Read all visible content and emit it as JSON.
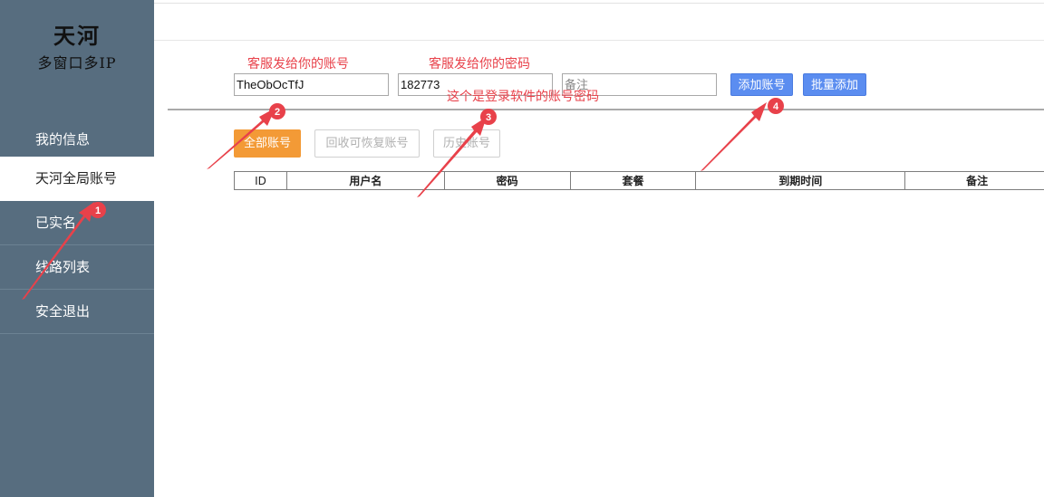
{
  "brand": {
    "line1": "天河",
    "line2": "多窗口多IP"
  },
  "sidebar": {
    "items": [
      {
        "label": "我的信息"
      },
      {
        "label": "天河全局账号",
        "active": true
      },
      {
        "label": "已实名"
      },
      {
        "label": "线路列表"
      },
      {
        "label": "安全退出"
      }
    ]
  },
  "form": {
    "username_value": "TheObOcTfJ",
    "password_value": "182773",
    "remark_placeholder": "备注",
    "add_button": "添加账号",
    "batch_add_button": "批量添加"
  },
  "filters": {
    "all": "全部账号",
    "recycle": "回收可恢复账号",
    "history": "历史账号"
  },
  "table": {
    "headers": [
      "ID",
      "用户名",
      "密码",
      "套餐",
      "到期时间",
      "备注"
    ]
  },
  "annotations": {
    "username_label": "客服发给你的账号",
    "password_label": "客服发给你的密码",
    "login_note": "这个是登录软件的账号密码",
    "badges": [
      "1",
      "2",
      "3",
      "4"
    ]
  },
  "colors": {
    "sidebar": "#576d7f",
    "primary_button": "#5b8df0",
    "active_filter": "#f39a36",
    "annotation": "#e8414a"
  }
}
